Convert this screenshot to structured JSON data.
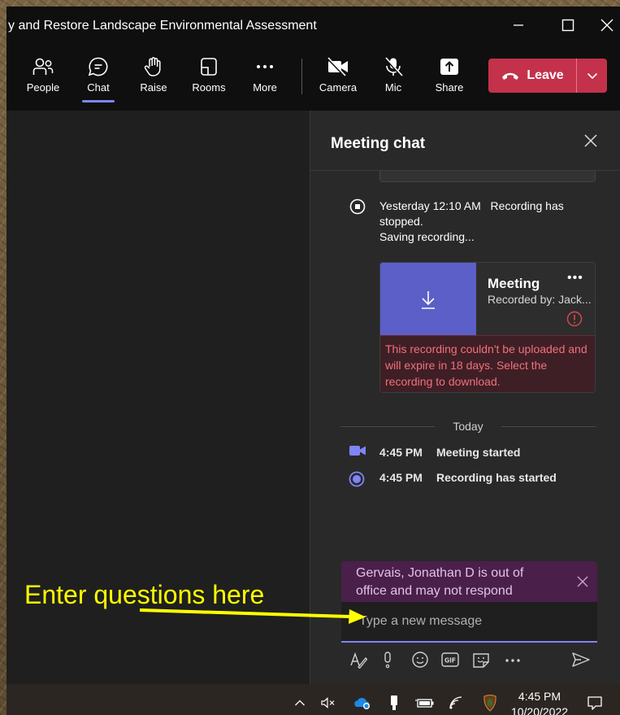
{
  "window": {
    "title": "y and Restore Landscape Environmental Assessment"
  },
  "toolbar": {
    "people": "People",
    "chat": "Chat",
    "raise": "Raise",
    "rooms": "Rooms",
    "more": "More",
    "camera": "Camera",
    "mic": "Mic",
    "share": "Share",
    "leave": "Leave"
  },
  "chat": {
    "title": "Meeting chat",
    "recording_stopped": {
      "time": "Yesterday 12:10 AM",
      "line1": "Recording has stopped.",
      "line2": "Saving recording..."
    },
    "recording_card": {
      "title": "Meeting",
      "subtitle": "Recorded by: Jack...",
      "more": "•••",
      "error": "This recording couldn't be uploaded and will expire in 18 days. Select the recording to download."
    },
    "divider_label": "Today",
    "events": [
      {
        "time": "4:45 PM",
        "text": "Meeting started"
      },
      {
        "time": "4:45 PM",
        "text": "Recording has started"
      }
    ],
    "oof_banner": "Gervais, Jonathan D is out of office and may not respond",
    "compose_placeholder": "Type a new message"
  },
  "annotation": {
    "text": "Enter questions here",
    "color": "#ffff00"
  },
  "taskbar": {
    "time": "4:45 PM",
    "date": "10/20/2022"
  },
  "colors": {
    "accent": "#7f85f5",
    "leave": "#c4314b",
    "recording_thumb": "#5b5fc7",
    "error_text": "#f1707b",
    "oof_bg": "#4a1f4a"
  }
}
